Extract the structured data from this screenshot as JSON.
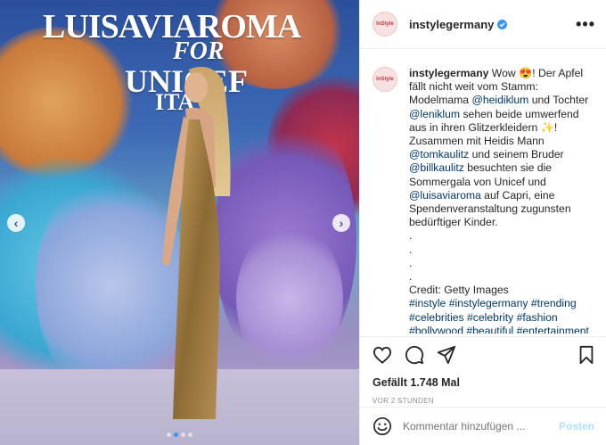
{
  "post": {
    "banner": {
      "line1": "LUISAVIAROMA",
      "line2": "FOR",
      "line3": "UNICEF",
      "line4": "ITA"
    },
    "carousel": {
      "total": 4,
      "active": 1,
      "prev_label": "‹",
      "next_label": "›"
    }
  },
  "header": {
    "avatar_text": "InStyle",
    "username": "instylegermany",
    "more_label": "•••"
  },
  "caption": {
    "username": "instylegermany",
    "text_parts": [
      " Wow 😍! Der Apfel fällt nicht weit vom Stamm: Modelmama ",
      "@heidiklum",
      " und Tochter ",
      "@leniklum",
      " sehen beide umwerfend aus in ihren Glitzerkleidern ✨! Zusammen mit Heidis Mann ",
      "@tomkaulitz",
      " und seinem Bruder ",
      "@billkaulitz",
      " besuchten sie die Sommergala von Unicef und ",
      "@luisaviaroma",
      " auf Capri, eine Spendenveranstaltung zugunsten bedürftiger Kinder.\n.\n.\n.\n.\nCredit: Getty Images\n",
      "#instyle #instylegermany #trending #celebrities #celebrity #fashion #bollywood #beautiful #entertainment"
    ]
  },
  "actions": {
    "likes": "Gefällt 1.748 Mal",
    "time": "VOR 2 STUNDEN"
  },
  "comment": {
    "placeholder": "Kommentar hinzufügen ...",
    "post_label": "Posten"
  },
  "colors": {
    "link": "#00376b",
    "verified": "#3897f0",
    "post_button_disabled": "#b2dffc"
  }
}
